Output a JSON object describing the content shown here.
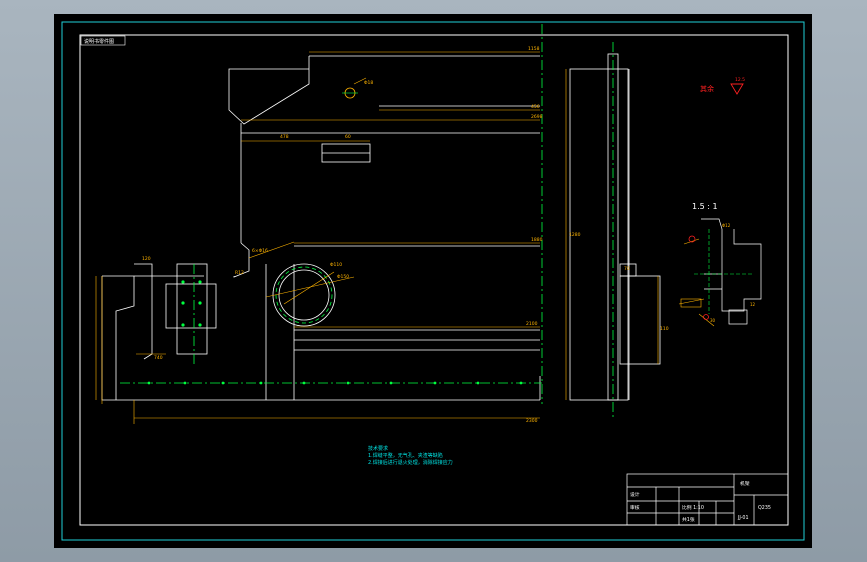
{
  "drawing": {
    "corner_label": "说明书零件图",
    "scale_label": "1.5 : 1",
    "remainder_label": "其余",
    "roughness_value": "12.5"
  },
  "dimensions": {
    "top_width": "1158",
    "offset_a": "456",
    "total_width": "2698",
    "slot_width": "478",
    "slot_height": "60",
    "hole_dia": "Φ18",
    "mid_width": "1880",
    "lower_width": "2100",
    "base_width": "2100",
    "overall_width": "2300",
    "rib_height": "120",
    "rib_spacing": "740",
    "bore_dia": "Φ110",
    "bolt_circle": "Φ150",
    "pcd_note": "6×Φ16",
    "height_left": "360",
    "chamfer": "R12",
    "side_height": "1280",
    "side_w": "110",
    "side_d": "70",
    "detail_a": "Φ12",
    "detail_b": "30",
    "detail_c": "12"
  },
  "notes": {
    "heading": "技术要求",
    "line1": "1.焊缝平整，无气孔、夹渣等缺陷",
    "line2": "2.焊接后进行退火处理，消除焊接应力"
  },
  "title_block": {
    "part_name": "机架",
    "material": "Q235",
    "drawing_no": "JJ-01",
    "designer": "设计",
    "checker": "审核",
    "scale": "比例 1:10",
    "sheet": "共1张"
  },
  "colors": {
    "background": "#000000",
    "border": "#ffffff",
    "outer_frame": "#1fd0d8",
    "part_outline": "#ffffff",
    "dimension": "#ffb400",
    "centerline": "#00ff40",
    "note_text": "#00e5e5",
    "accent_red": "#ff2020"
  }
}
